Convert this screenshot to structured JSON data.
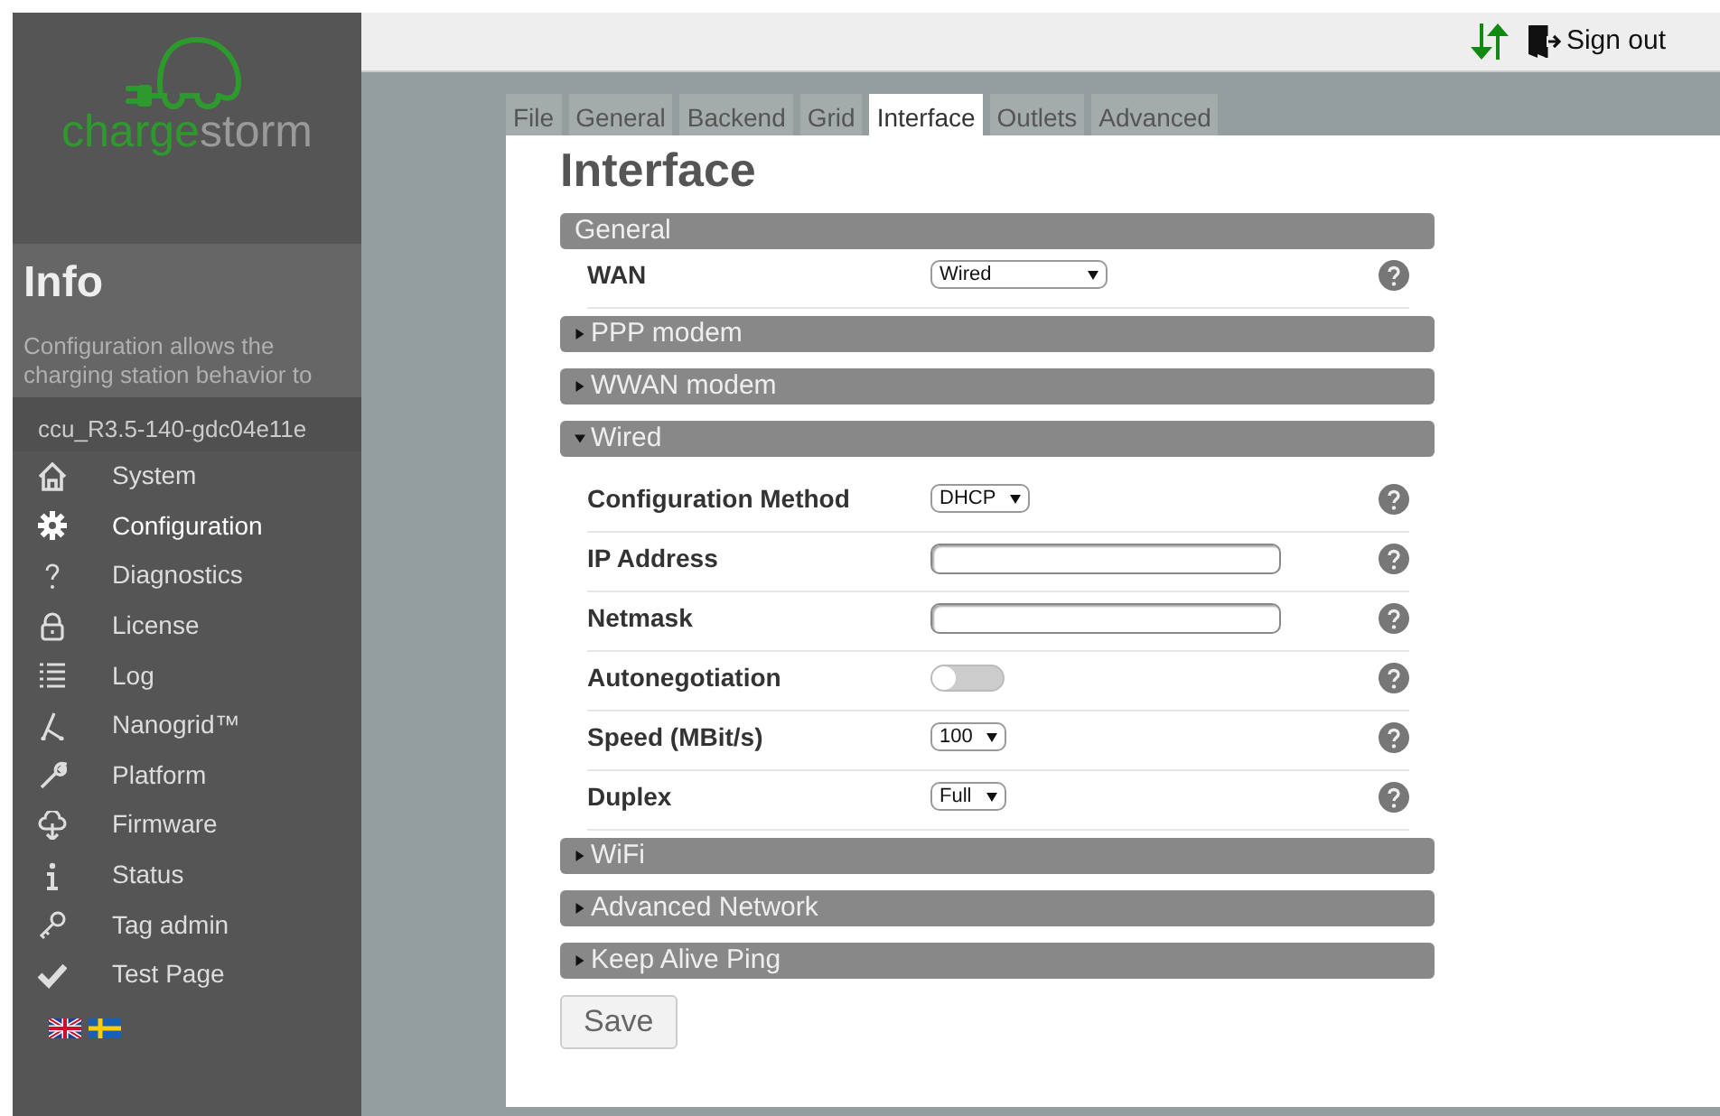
{
  "brand": {
    "name_part_1": "charge",
    "name_part_2": "storm"
  },
  "info": {
    "title": "Info",
    "description": "Configuration allows the charging station behavior to"
  },
  "version": "ccu_R3.5-140-gdc04e11e",
  "sidebar": {
    "items": [
      {
        "label": "System",
        "selected": false
      },
      {
        "label": "Configuration",
        "selected": true
      },
      {
        "label": "Diagnostics",
        "selected": false
      },
      {
        "label": "License",
        "selected": false
      },
      {
        "label": "Log",
        "selected": false
      },
      {
        "label": "Nanogrid™",
        "selected": false
      },
      {
        "label": "Platform",
        "selected": false
      },
      {
        "label": "Firmware",
        "selected": false
      },
      {
        "label": "Status",
        "selected": false
      },
      {
        "label": "Tag admin",
        "selected": false
      },
      {
        "label": "Test Page",
        "selected": false
      }
    ]
  },
  "header": {
    "sign_out": "Sign out"
  },
  "tabs": [
    {
      "label": "File",
      "selected": false
    },
    {
      "label": "General",
      "selected": false
    },
    {
      "label": "Backend",
      "selected": false
    },
    {
      "label": "Grid",
      "selected": false
    },
    {
      "label": "Interface",
      "selected": true
    },
    {
      "label": "Outlets",
      "selected": false
    },
    {
      "label": "Advanced",
      "selected": false
    }
  ],
  "page_title": "Interface",
  "sections": [
    {
      "title": "General",
      "kind": "static",
      "fields": [
        {
          "label": "WAN",
          "kind": "select",
          "value": "Wired"
        }
      ]
    },
    {
      "title": "PPP modem",
      "kind": "collapsible",
      "expanded": false
    },
    {
      "title": "WWAN modem",
      "kind": "collapsible",
      "expanded": false
    },
    {
      "title": "Wired",
      "kind": "collapsible",
      "expanded": true,
      "fields": [
        {
          "label": "Configuration Method",
          "kind": "select",
          "value": "DHCP"
        },
        {
          "label": "IP Address",
          "kind": "input"
        },
        {
          "label": "Netmask",
          "kind": "input"
        },
        {
          "label": "Autonegotiation",
          "kind": "toggle",
          "on": false
        },
        {
          "label": "Speed (MBit/s)",
          "kind": "select",
          "value": "100"
        },
        {
          "label": "Duplex",
          "kind": "select",
          "value": "Full"
        }
      ]
    },
    {
      "title": "WiFi",
      "kind": "collapsible",
      "expanded": false
    },
    {
      "title": "Advanced Network",
      "kind": "collapsible",
      "expanded": false
    },
    {
      "title": "Keep Alive Ping",
      "kind": "collapsible",
      "expanded": false
    }
  ],
  "save_button": "Save"
}
